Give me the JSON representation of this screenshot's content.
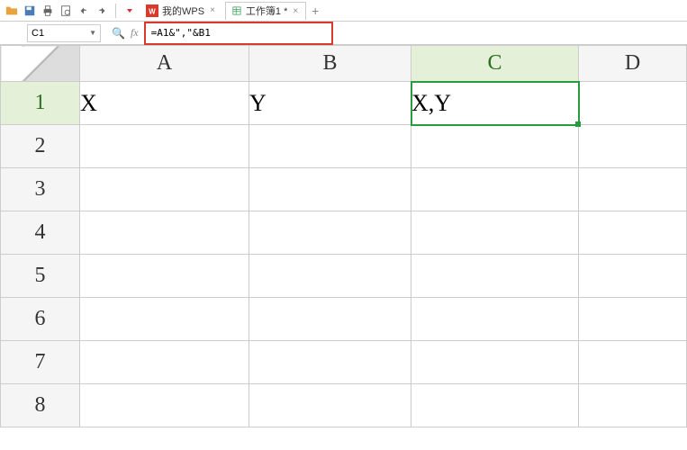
{
  "toolbar": {
    "tabs": [
      {
        "label": "我的WPS",
        "icon": "wps"
      },
      {
        "label": "工作簿1 *",
        "icon": "xls"
      }
    ]
  },
  "formula_bar": {
    "name_box": "C1",
    "formula": "=A1&\",\"&B1",
    "fx_label": "fx"
  },
  "columns": [
    "A",
    "B",
    "C",
    "D"
  ],
  "rows": [
    "1",
    "2",
    "3",
    "4",
    "5",
    "6",
    "7",
    "8"
  ],
  "selected_col": "C",
  "selected_row": "1",
  "cells": {
    "A1": "X",
    "B1": "Y",
    "C1": "X,Y"
  },
  "chart_data": {
    "type": "table",
    "columns": [
      "A",
      "B",
      "C"
    ],
    "rows": [
      {
        "A": "X",
        "B": "Y",
        "C": "X,Y"
      }
    ]
  }
}
